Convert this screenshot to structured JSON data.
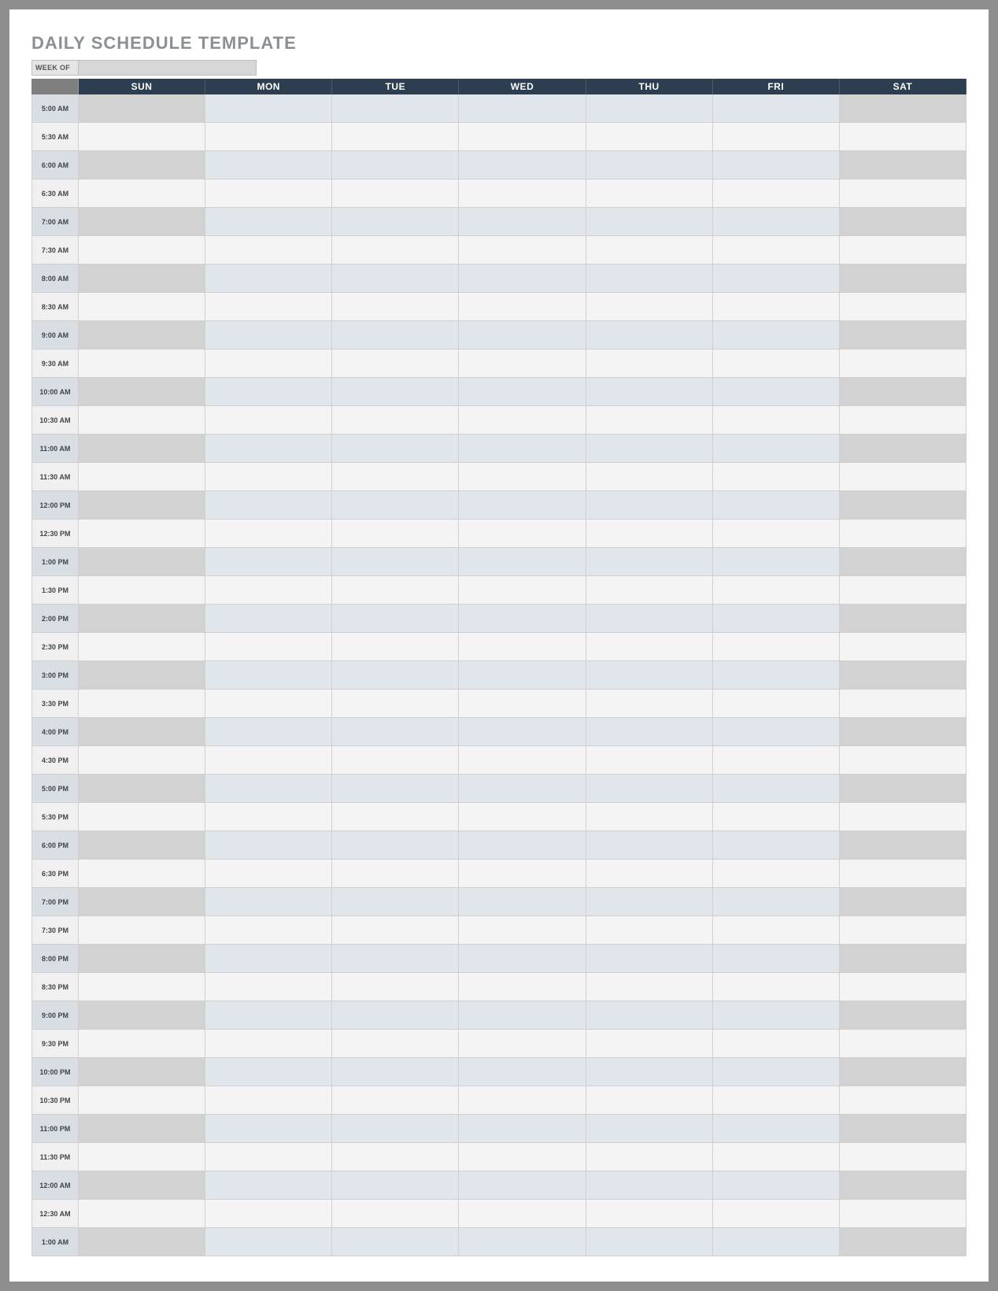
{
  "title": "DAILY SCHEDULE TEMPLATE",
  "week_of_label": "WEEK OF",
  "week_of_value": "",
  "days": [
    "SUN",
    "MON",
    "TUE",
    "WED",
    "THU",
    "FRI",
    "SAT"
  ],
  "times": [
    "5:00 AM",
    "5:30 AM",
    "6:00 AM",
    "6:30 AM",
    "7:00 AM",
    "7:30 AM",
    "8:00 AM",
    "8:30 AM",
    "9:00 AM",
    "9:30 AM",
    "10:00 AM",
    "10:30 AM",
    "11:00 AM",
    "11:30 AM",
    "12:00 PM",
    "12:30 PM",
    "1:00 PM",
    "1:30 PM",
    "2:00 PM",
    "2:30 PM",
    "3:00 PM",
    "3:30 PM",
    "4:00 PM",
    "4:30 PM",
    "5:00 PM",
    "5:30 PM",
    "6:00 PM",
    "6:30 PM",
    "7:00 PM",
    "7:30 PM",
    "8:00 PM",
    "8:30 PM",
    "9:00 PM",
    "9:30 PM",
    "10:00 PM",
    "10:30 PM",
    "11:00 PM",
    "11:30 PM",
    "12:00 AM",
    "12:30 AM",
    "1:00 AM"
  ],
  "cells": {}
}
